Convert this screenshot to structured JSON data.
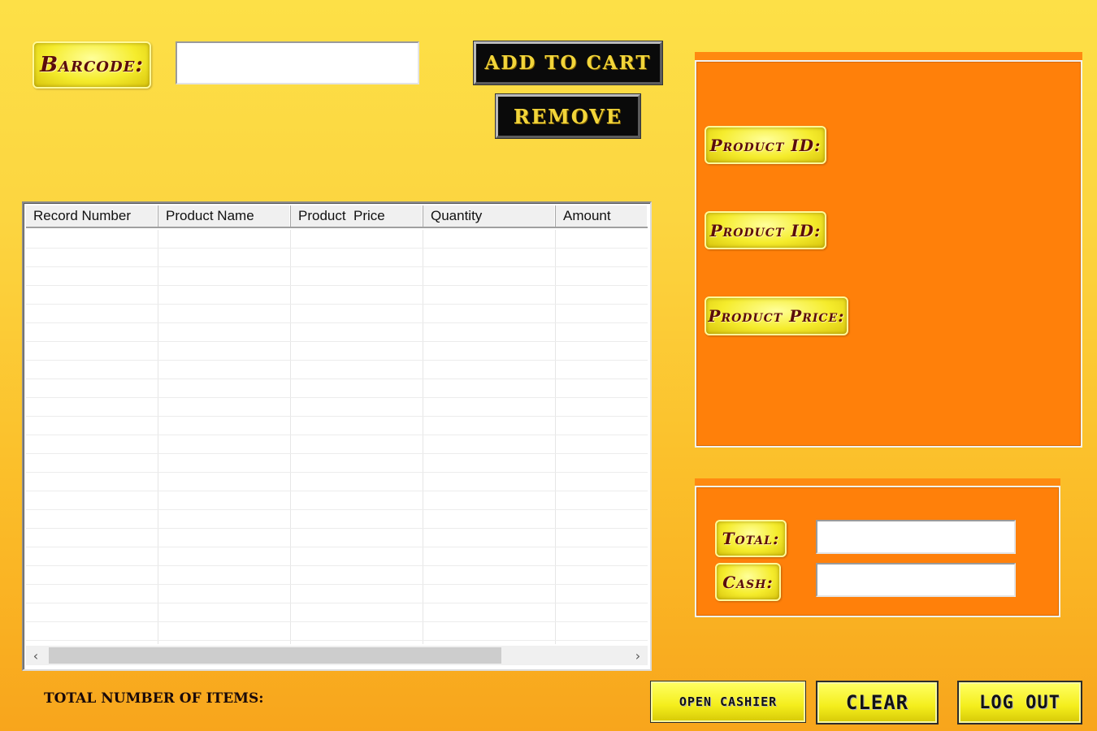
{
  "top": {
    "barcode_label": "Barcode:",
    "barcode_value": "",
    "add_to_cart_label": "ADD TO CART",
    "remove_label": "REMOVE"
  },
  "table": {
    "columns": [
      "Record Number",
      "Product Name",
      "Product  Price",
      "Quantity",
      "Amount"
    ]
  },
  "product_panel": {
    "product_id_label_1": "Product ID:",
    "product_id_label_2": "Product ID:",
    "product_price_label": "Product Price:"
  },
  "totals_panel": {
    "total_label": "Total:",
    "total_value": "",
    "cash_label": "Cash:",
    "cash_value": ""
  },
  "footer": {
    "total_items_label": "TOTAL NUMBER OF ITEMS:",
    "open_cashier_label": "OPEN CASHIER",
    "clear_label": "CLEAR",
    "log_out_label": "LOG OUT"
  },
  "colors": {
    "background_top": "#fde047",
    "background_bottom": "#f8a51c",
    "panel_orange": "#ff800a",
    "chip_gold": "#f5ec2c",
    "label_text": "#5a0c0c",
    "button_black": "#0a0a0a",
    "button_text_gold": "#f2d53a"
  },
  "icons": {
    "scroll_left": "chevron-left-icon",
    "scroll_right": "chevron-right-icon"
  }
}
